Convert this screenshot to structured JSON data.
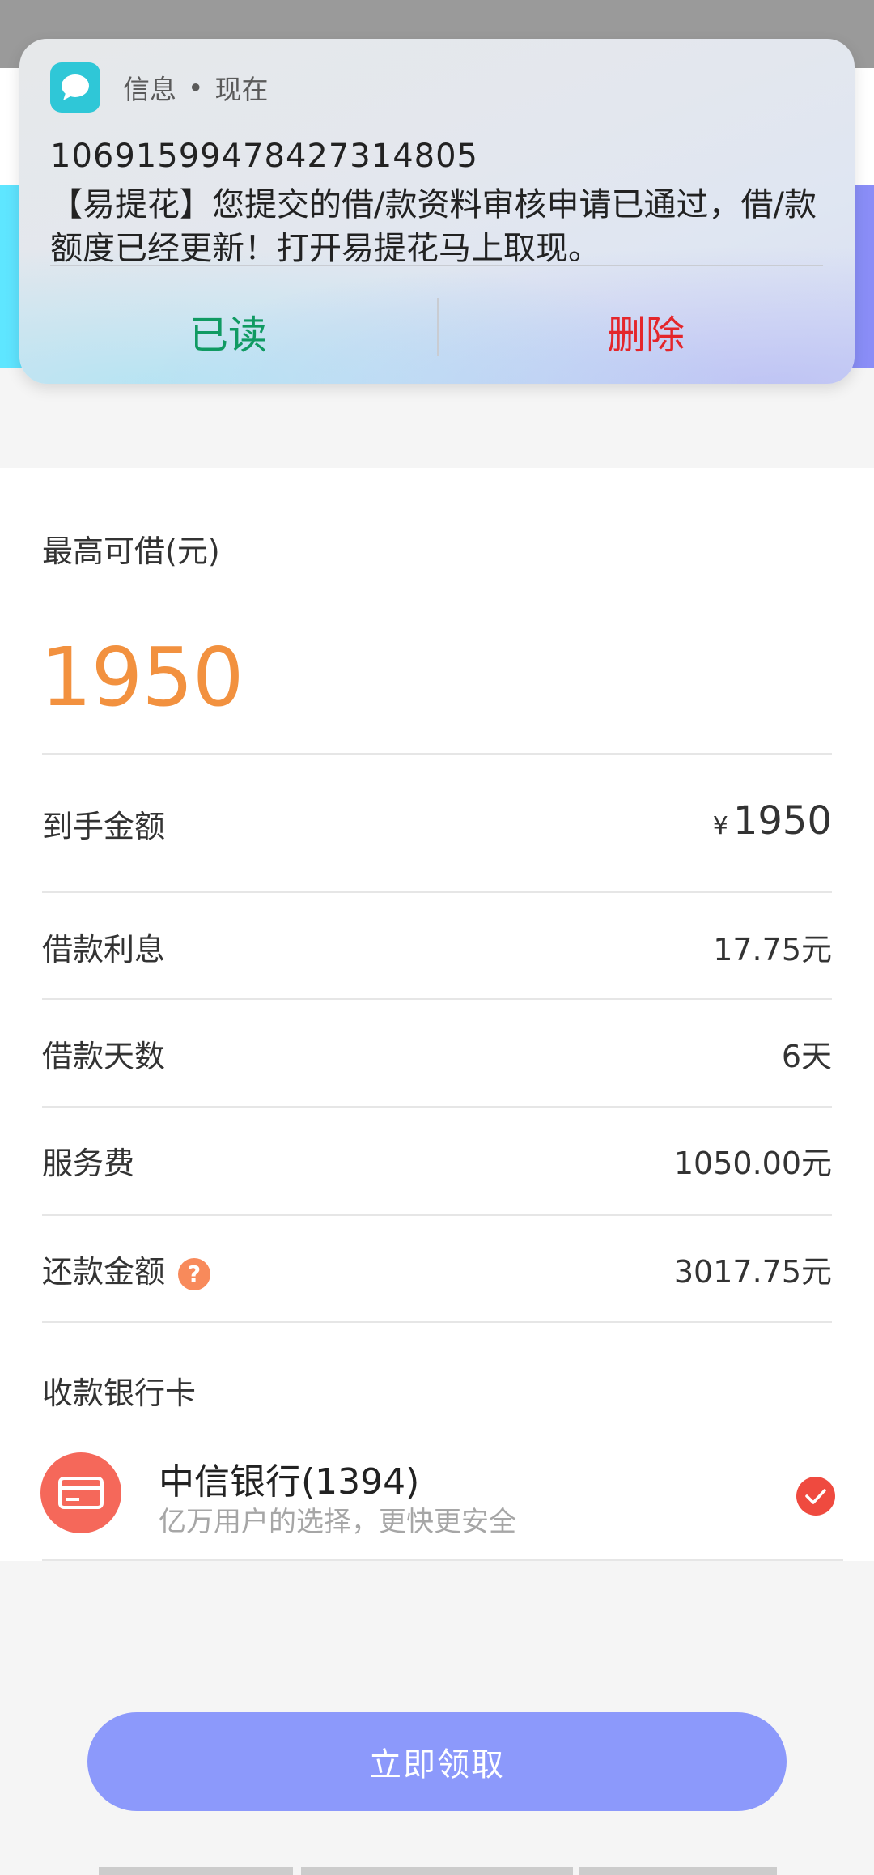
{
  "notification": {
    "app_name": "信息",
    "separator": "•",
    "time": "现在",
    "sender": "1069159947842731480​5",
    "body": "【易提花】您提交的借/款资料审核申请已通过，借/款额度已经更新！打开易提花马上取现。",
    "action_read": "已读",
    "action_delete": "删除",
    "icon": "message-bubble-icon",
    "icon_color": "#2fc7d7"
  },
  "loan": {
    "max_label": "最高可借(元)",
    "max_amount": "1950",
    "accent_color": "#f2913f",
    "rows": [
      {
        "label": "到手金额",
        "currency": "¥",
        "value": "1950"
      },
      {
        "label": "借款利息",
        "value": "17.75元"
      },
      {
        "label": "借款天数",
        "value": "6天"
      },
      {
        "label": "服务费",
        "value": "1050.00元"
      },
      {
        "label": "还款金额",
        "value": "3017.75元",
        "help": "?"
      }
    ]
  },
  "bank": {
    "section_label": "收款银行卡",
    "name": "中信银行(1394)",
    "subtitle": "亿万用户的选择，更快更安全",
    "icon": "bank-card-icon",
    "selected_icon": "check-icon"
  },
  "cta": {
    "label": "立即领取",
    "color": "#8c99fb"
  }
}
